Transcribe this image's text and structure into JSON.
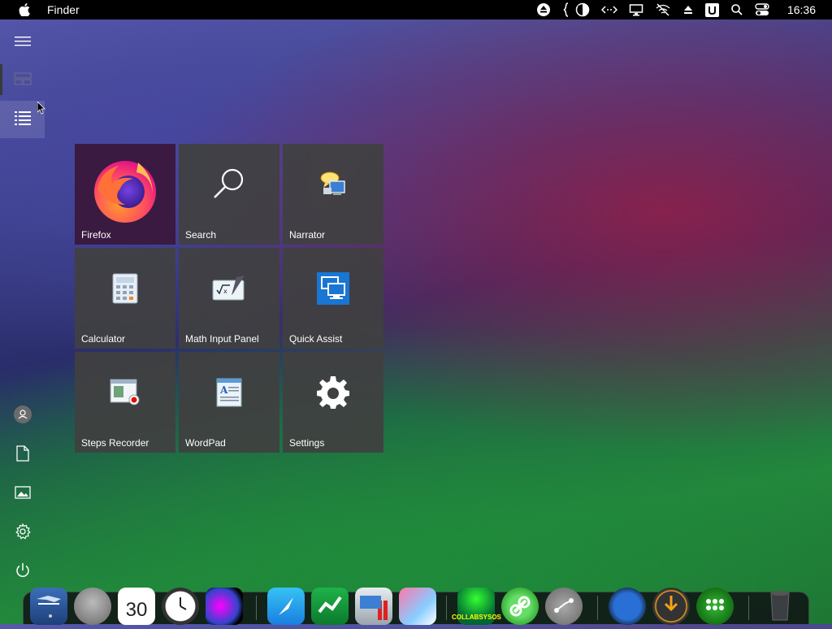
{
  "menubar": {
    "app_name": "Finder",
    "clock": "16:36",
    "status_icons": [
      "eject-icon",
      "script-icon",
      "half-moon-icon",
      "code-arrows-icon",
      "display-icon",
      "no-wifi-icon",
      "upload-icon",
      "u-icon",
      "search-icon",
      "control-center-icon"
    ]
  },
  "rail": {
    "items": [
      "hamburger-menu-icon",
      "tiles-view-icon",
      "list-view-icon",
      "user-avatar-icon",
      "documents-icon",
      "pictures-icon",
      "settings-icon",
      "power-icon"
    ]
  },
  "tiles": [
    {
      "label": "Firefox",
      "icon": "firefox-icon"
    },
    {
      "label": "Search",
      "icon": "search-icon"
    },
    {
      "label": "Narrator",
      "icon": "narrator-icon"
    },
    {
      "label": "Calculator",
      "icon": "calculator-icon"
    },
    {
      "label": "Math Input Panel",
      "icon": "math-input-icon"
    },
    {
      "label": "Quick Assist",
      "icon": "quick-assist-icon"
    },
    {
      "label": "Steps Recorder",
      "icon": "steps-recorder-icon"
    },
    {
      "label": "WordPad",
      "icon": "wordpad-icon"
    },
    {
      "label": "Settings",
      "icon": "gear-icon"
    }
  ],
  "dock": {
    "calendar_day": "30",
    "collabsysos_label": "COLLABSYSOS",
    "items": [
      "finder-icon",
      "launchpad-icon",
      "calendar-icon",
      "clock-icon",
      "siri-icon",
      "safari-icon",
      "stock-app-icon",
      "flashcards-icon",
      "photo-editor-icon",
      "collabsysos-icon",
      "link-app-icon",
      "route-app-icon",
      "www-icon",
      "downloads-icon",
      "dots-app-icon",
      "trash-icon"
    ]
  },
  "colors": {
    "tile_bg": "#404040",
    "firefox_tile_bg": "#3a1a40",
    "menubar_bg": "#000000"
  }
}
